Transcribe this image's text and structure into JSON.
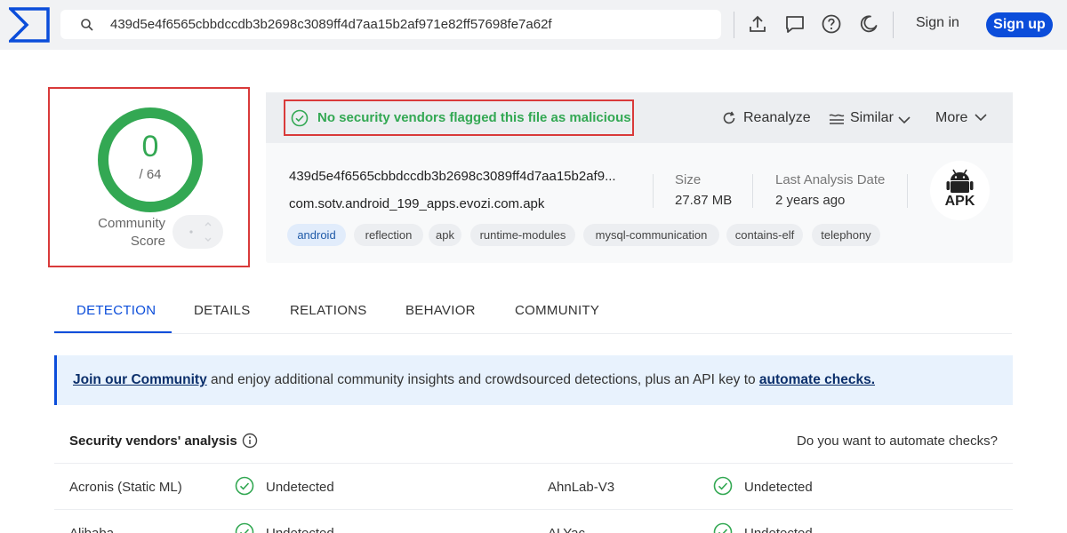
{
  "search": {
    "value": "439d5e4f6565cbbdccdb3b2698c3089ff4d7aa15b2af971e82ff57698fe7a62f"
  },
  "header": {
    "sign_in": "Sign in",
    "sign_up": "Sign up"
  },
  "score": {
    "detections": "0",
    "total": "/ 64",
    "community_label_1": "Community",
    "community_label_2": "Score"
  },
  "verdict": {
    "text": "No security vendors flagged this file as malicious"
  },
  "actions": {
    "reanalyze": "Reanalyze",
    "similar": "Similar",
    "more": "More"
  },
  "file": {
    "hash": "439d5e4f6565cbbdccdb3b2698c3089ff4d7aa15b2af9...",
    "name": "com.sotv.android_199_apps.evozi.com.apk",
    "size_label": "Size",
    "size_value": "27.87 MB",
    "date_label": "Last Analysis Date",
    "date_value": "2 years ago",
    "type": "APK",
    "tags": [
      "android",
      "reflection",
      "apk",
      "runtime-modules",
      "mysql-communication",
      "contains-elf",
      "telephony"
    ]
  },
  "tabs": [
    "DETECTION",
    "DETAILS",
    "RELATIONS",
    "BEHAVIOR",
    "COMMUNITY"
  ],
  "banner": {
    "link1": "Join our Community",
    "middle": " and enjoy additional community insights and crowdsourced detections, plus an API key to ",
    "link2": "automate checks."
  },
  "vendors": {
    "title": "Security vendors' analysis",
    "automate": "Do you want to automate checks?",
    "rows": [
      {
        "left_name": "Acronis (Static ML)",
        "left_result": "Undetected",
        "right_name": "AhnLab-V3",
        "right_result": "Undetected"
      },
      {
        "left_name": "Alibaba",
        "left_result": "Undetected",
        "right_name": "ALYac",
        "right_result": "Undetected"
      }
    ]
  },
  "colors": {
    "accent": "#0b4dda",
    "success": "#33a853",
    "highlight_border": "#d93a3a"
  }
}
